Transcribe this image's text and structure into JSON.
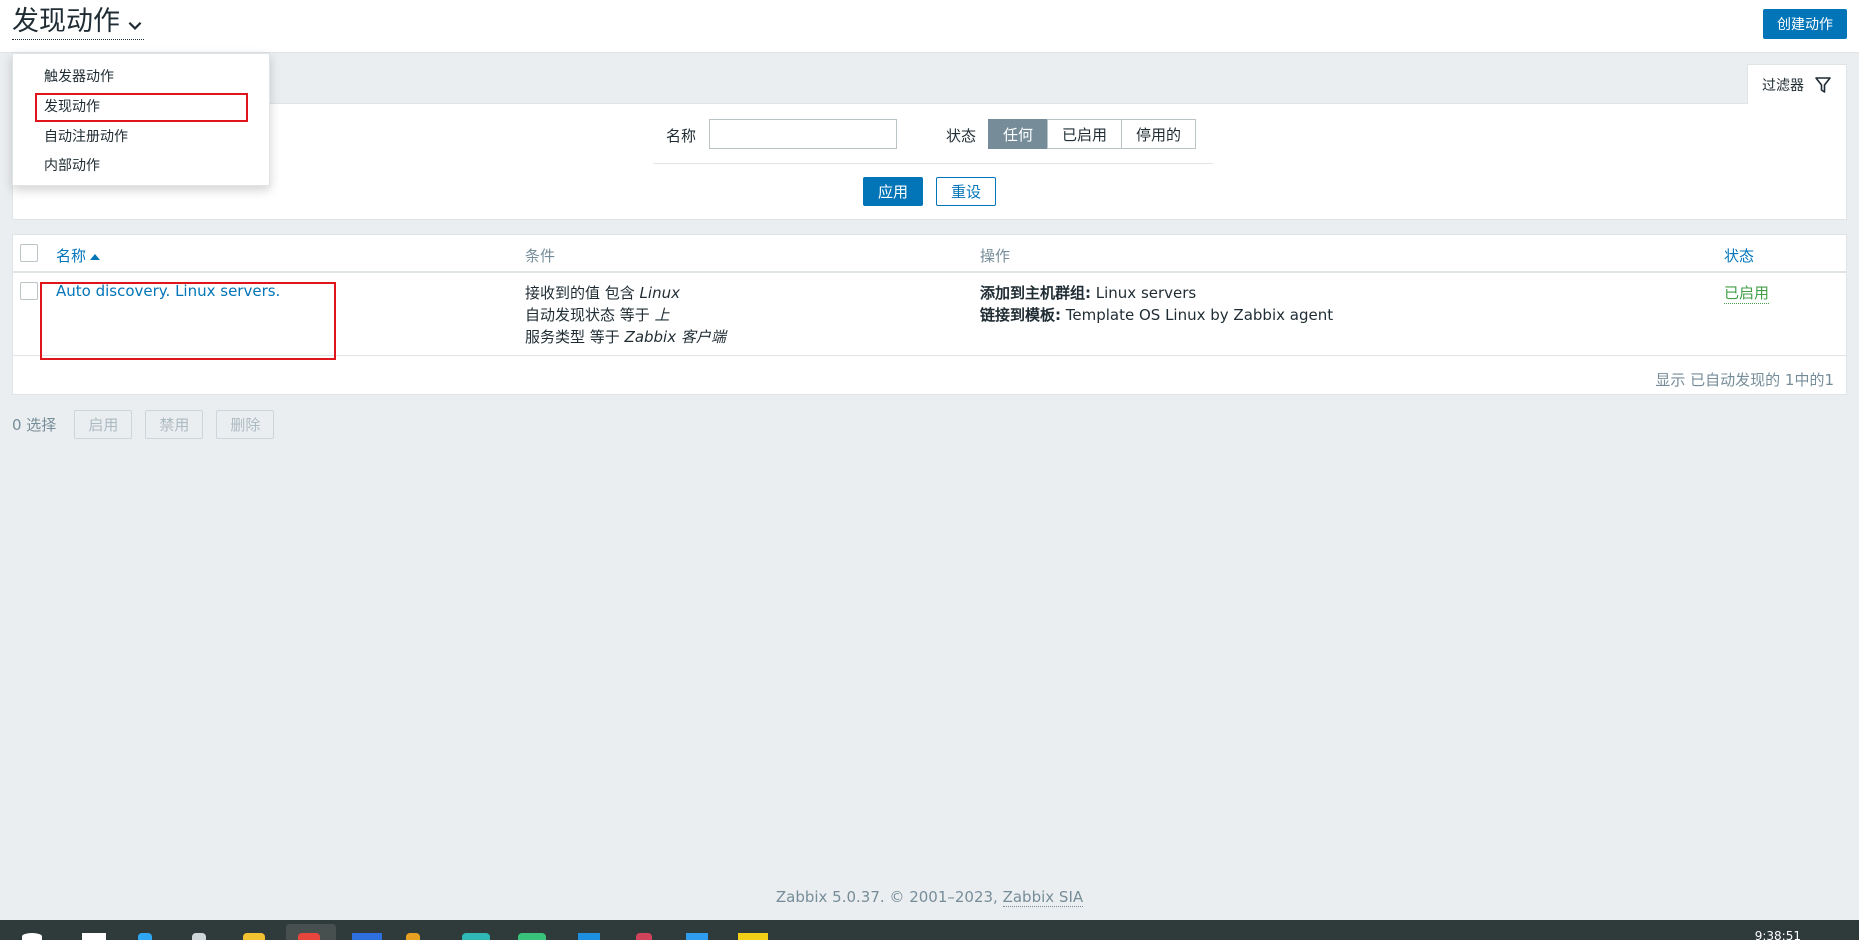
{
  "header": {
    "title": "发现动作",
    "create_button": "创建动作"
  },
  "dropdown": {
    "items": [
      "触发器动作",
      "发现动作",
      "自动注册动作",
      "内部动作"
    ]
  },
  "filter": {
    "tab_label": "过滤器",
    "name_label": "名称",
    "name_value": "",
    "status_label": "状态",
    "status_options": [
      "任何",
      "已启用",
      "停用的"
    ],
    "status_selected": "任何",
    "apply_label": "应用",
    "reset_label": "重设"
  },
  "table": {
    "columns": {
      "name": "名称",
      "conditions": "条件",
      "operations": "操作",
      "status": "状态"
    },
    "rows": [
      {
        "name": "Auto discovery. Linux servers.",
        "conditions": [
          {
            "text": "接收到的值 包含 ",
            "value": "Linux"
          },
          {
            "text": "自动发现状态 等于 ",
            "value": "上"
          },
          {
            "text": "服务类型 等于 ",
            "value": "Zabbix 客户端"
          }
        ],
        "operations": [
          {
            "label": "添加到主机群组:",
            "value": " Linux servers"
          },
          {
            "label": "链接到模板:",
            "value": " Template OS Linux by Zabbix agent"
          }
        ],
        "status": "已启用"
      }
    ],
    "footer": "显示 已自动发现的 1中的1"
  },
  "mass_actions": {
    "count": "0 选择",
    "buttons": [
      "启用",
      "禁用",
      "删除"
    ]
  },
  "page_footer": {
    "text": "Zabbix 5.0.37. © 2001–2023, ",
    "link": "Zabbix SIA"
  },
  "taskbar": {
    "clock": "9:38:51"
  },
  "colors": {
    "accent": "#0275b8",
    "enabled": "#429e47",
    "highlight": "#e0141b",
    "muted": "#768d99"
  }
}
